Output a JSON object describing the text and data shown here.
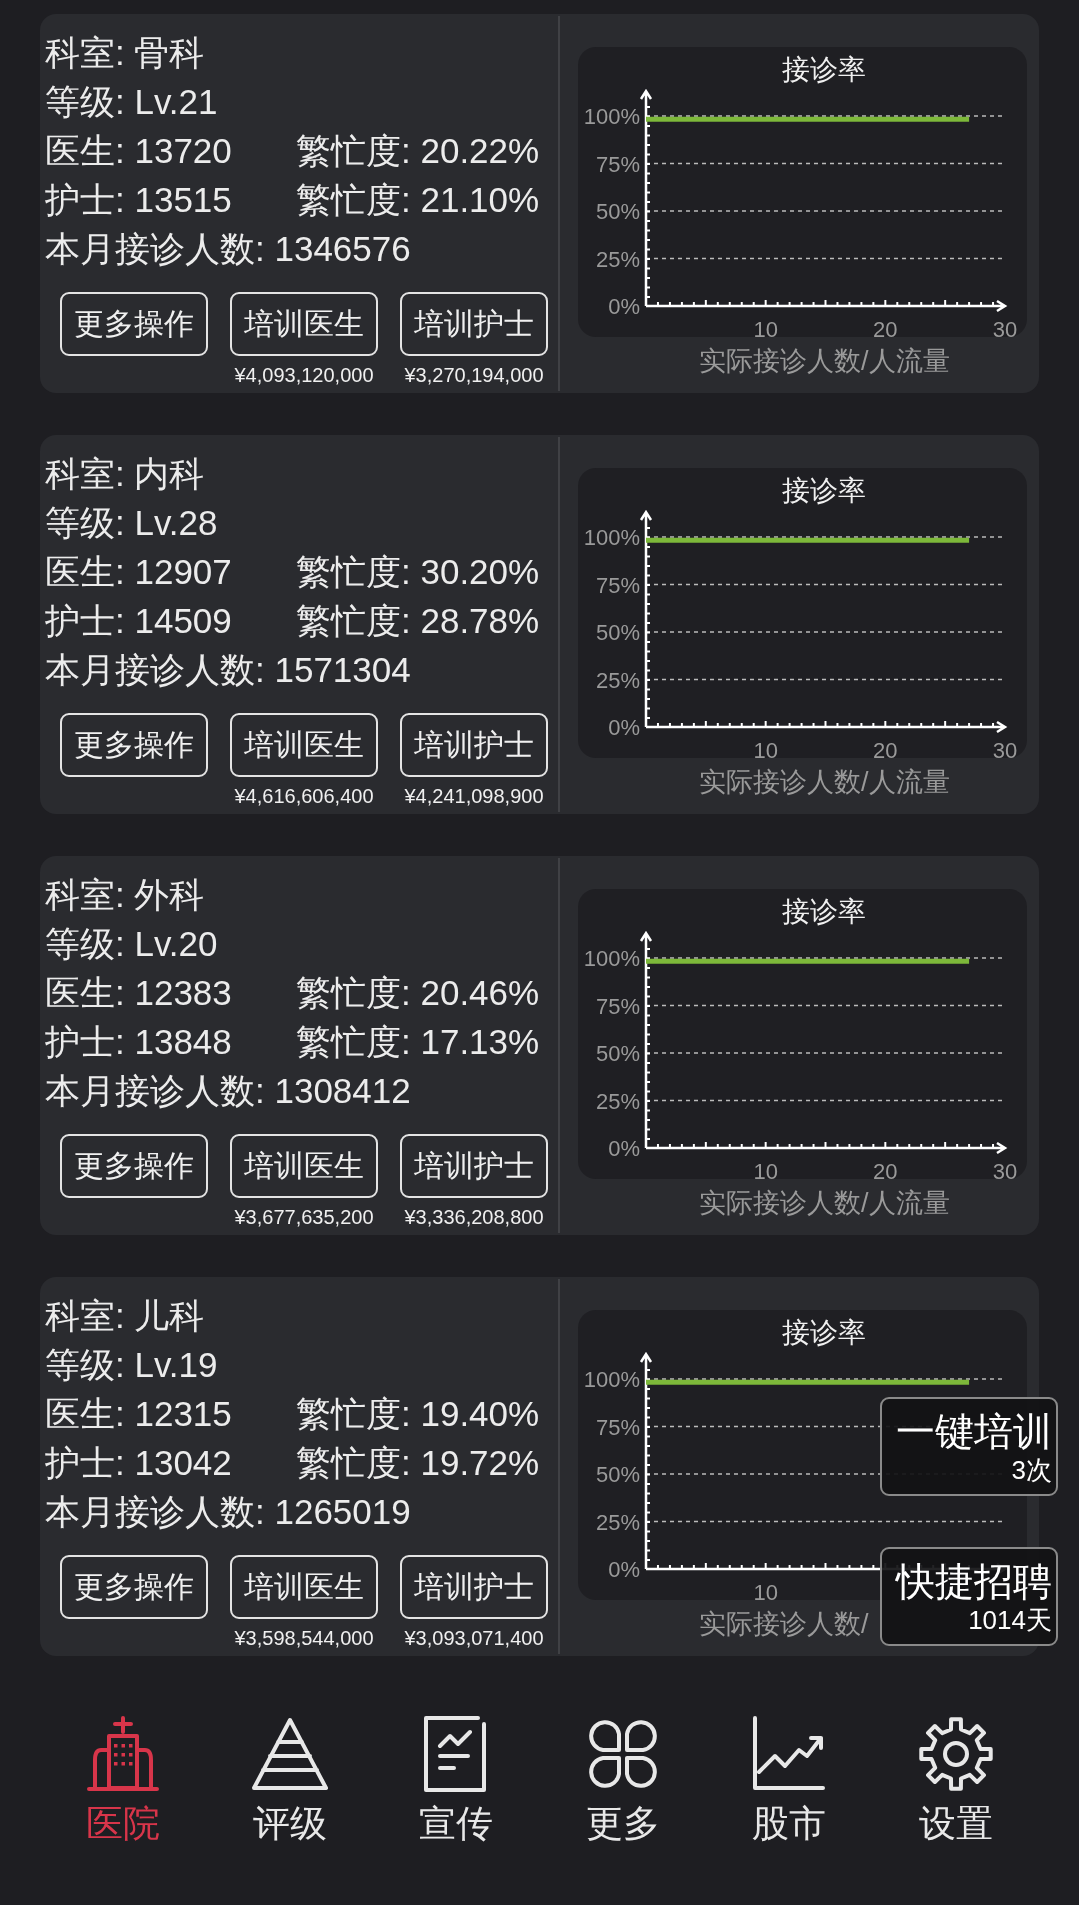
{
  "departments": [
    {
      "department": "科室: 骨科",
      "grade": "等级: Lv.21",
      "doctors": "医生: 13720",
      "doctor_busyness": "繁忙度: 20.22%",
      "nurses": "护士: 13515",
      "nurse_busyness": "繁忙度: 21.10%",
      "patients_this_month": "本月接诊人数: 1346576",
      "buttons": [
        {
          "label": "更多操作"
        },
        {
          "label": "培训医生",
          "cost": "¥4,093,120,000"
        },
        {
          "label": "培训护士",
          "cost": "¥3,270,194,000"
        }
      ],
      "chart_data": {
        "type": "line",
        "grid": true,
        "title": "接诊率",
        "xlabel": "实际接诊人数/人流量",
        "ylim": [
          0,
          100
        ],
        "yticks": [
          {
            "value": 0,
            "label": "0%"
          },
          {
            "value": 25,
            "label": "25%"
          },
          {
            "value": 50,
            "label": "50%"
          },
          {
            "value": 75,
            "label": "75%"
          },
          {
            "value": 100,
            "label": "100%"
          }
        ],
        "categories": [
          null,
          null,
          null,
          null,
          null,
          null,
          null,
          null,
          null,
          null,
          "10",
          null,
          null,
          null,
          null,
          null,
          null,
          null,
          null,
          null,
          "20",
          null,
          null,
          null,
          null,
          null,
          null,
          null,
          null,
          null,
          "30"
        ],
        "series": [
          {
            "color": "#7db83a",
            "values": [
              98.3,
              98.3,
              98.3,
              98.3,
              98.3,
              98.3,
              98.3,
              98.3,
              98.3,
              98.3,
              98.3,
              98.3,
              98.3,
              98.3,
              98.3,
              98.3,
              98.3,
              98.3,
              98.3,
              98.3,
              98.3,
              98.3,
              98.3,
              98.3,
              98.3,
              98.3,
              98.3,
              98.3,
              null,
              null,
              null
            ]
          }
        ]
      }
    },
    {
      "department": "科室: 内科",
      "grade": "等级: Lv.28",
      "doctors": "医生: 12907",
      "doctor_busyness": "繁忙度: 30.20%",
      "nurses": "护士: 14509",
      "nurse_busyness": "繁忙度: 28.78%",
      "patients_this_month": "本月接诊人数: 1571304",
      "buttons": [
        {
          "label": "更多操作"
        },
        {
          "label": "培训医生",
          "cost": "¥4,616,606,400"
        },
        {
          "label": "培训护士",
          "cost": "¥4,241,098,900"
        }
      ],
      "chart_data": {
        "type": "line",
        "grid": true,
        "title": "接诊率",
        "xlabel": "实际接诊人数/人流量",
        "ylim": [
          0,
          100
        ],
        "yticks": [
          {
            "value": 0,
            "label": "0%"
          },
          {
            "value": 25,
            "label": "25%"
          },
          {
            "value": 50,
            "label": "50%"
          },
          {
            "value": 75,
            "label": "75%"
          },
          {
            "value": 100,
            "label": "100%"
          }
        ],
        "categories": [
          null,
          null,
          null,
          null,
          null,
          null,
          null,
          null,
          null,
          null,
          "10",
          null,
          null,
          null,
          null,
          null,
          null,
          null,
          null,
          null,
          "20",
          null,
          null,
          null,
          null,
          null,
          null,
          null,
          null,
          null,
          "30"
        ],
        "series": [
          {
            "color": "#7db83a",
            "values": [
              98.3,
              98.3,
              98.3,
              98.3,
              98.3,
              98.3,
              98.3,
              98.3,
              98.3,
              98.3,
              98.3,
              98.3,
              98.3,
              98.3,
              98.3,
              98.3,
              98.3,
              98.3,
              98.3,
              98.3,
              98.3,
              98.3,
              98.3,
              98.3,
              98.3,
              98.3,
              98.3,
              98.3,
              null,
              null,
              null
            ]
          }
        ]
      }
    },
    {
      "department": "科室: 外科",
      "grade": "等级: Lv.20",
      "doctors": "医生: 12383",
      "doctor_busyness": "繁忙度: 20.46%",
      "nurses": "护士: 13848",
      "nurse_busyness": "繁忙度: 17.13%",
      "patients_this_month": "本月接诊人数: 1308412",
      "buttons": [
        {
          "label": "更多操作"
        },
        {
          "label": "培训医生",
          "cost": "¥3,677,635,200"
        },
        {
          "label": "培训护士",
          "cost": "¥3,336,208,800"
        }
      ],
      "chart_data": {
        "type": "line",
        "grid": true,
        "title": "接诊率",
        "xlabel": "实际接诊人数/人流量",
        "ylim": [
          0,
          100
        ],
        "yticks": [
          {
            "value": 0,
            "label": "0%"
          },
          {
            "value": 25,
            "label": "25%"
          },
          {
            "value": 50,
            "label": "50%"
          },
          {
            "value": 75,
            "label": "75%"
          },
          {
            "value": 100,
            "label": "100%"
          }
        ],
        "categories": [
          null,
          null,
          null,
          null,
          null,
          null,
          null,
          null,
          null,
          null,
          "10",
          null,
          null,
          null,
          null,
          null,
          null,
          null,
          null,
          null,
          "20",
          null,
          null,
          null,
          null,
          null,
          null,
          null,
          null,
          null,
          "30"
        ],
        "series": [
          {
            "color": "#7db83a",
            "values": [
              98.3,
              98.3,
              98.3,
              98.3,
              98.3,
              98.3,
              98.3,
              98.3,
              98.3,
              98.3,
              98.3,
              98.3,
              98.3,
              98.3,
              98.3,
              98.3,
              98.3,
              98.3,
              98.3,
              98.3,
              98.3,
              98.3,
              98.3,
              98.3,
              98.3,
              98.3,
              98.3,
              98.3,
              null,
              null,
              null
            ]
          }
        ]
      }
    },
    {
      "department": "科室: 儿科",
      "grade": "等级: Lv.19",
      "doctors": "医生: 12315",
      "doctor_busyness": "繁忙度: 19.40%",
      "nurses": "护士: 13042",
      "nurse_busyness": "繁忙度: 19.72%",
      "patients_this_month": "本月接诊人数: 1265019",
      "buttons": [
        {
          "label": "更多操作"
        },
        {
          "label": "培训医生",
          "cost": "¥3,598,544,000"
        },
        {
          "label": "培训护士",
          "cost": "¥3,093,071,400"
        }
      ],
      "chart_data": {
        "type": "line",
        "grid": true,
        "title": "接诊率",
        "xlabel": "实际接诊人数/",
        "ylim": [
          0,
          100
        ],
        "yticks": [
          {
            "value": 0,
            "label": "0%"
          },
          {
            "value": 25,
            "label": "25%"
          },
          {
            "value": 50,
            "label": "50%"
          },
          {
            "value": 75,
            "label": "75%"
          },
          {
            "value": 100,
            "label": "100%"
          }
        ],
        "categories": [
          null,
          null,
          null,
          null,
          null,
          null,
          null,
          null,
          null,
          null,
          "10",
          null,
          null,
          null,
          null,
          null,
          null,
          null,
          null,
          null,
          null,
          null,
          null,
          null,
          null,
          null,
          null,
          null,
          null,
          null,
          null
        ],
        "series": [
          {
            "color": "#7db83a",
            "values": [
              98.3,
              98.3,
              98.3,
              98.3,
              98.3,
              98.3,
              98.3,
              98.3,
              98.3,
              98.3,
              98.3,
              98.3,
              98.3,
              98.3,
              98.3,
              98.3,
              98.3,
              98.3,
              98.3,
              98.3,
              98.3,
              98.3,
              98.3,
              98.3,
              98.3,
              98.3,
              98.3,
              98.3,
              null,
              null,
              null
            ]
          }
        ]
      }
    }
  ],
  "floating_buttons": [
    {
      "label": "一键培训",
      "note": "3次"
    },
    {
      "label": "快捷招聘",
      "note": "1014天"
    }
  ],
  "nav": [
    {
      "label": "医院",
      "kind": "hospital",
      "selected": true
    },
    {
      "label": "评级",
      "kind": "pyramid",
      "selected": false
    },
    {
      "label": "宣传",
      "kind": "document",
      "selected": false
    },
    {
      "label": "更多",
      "kind": "petals",
      "selected": false
    },
    {
      "label": "股市",
      "kind": "stock",
      "selected": false
    },
    {
      "label": "设置",
      "kind": "gear",
      "selected": false
    }
  ]
}
